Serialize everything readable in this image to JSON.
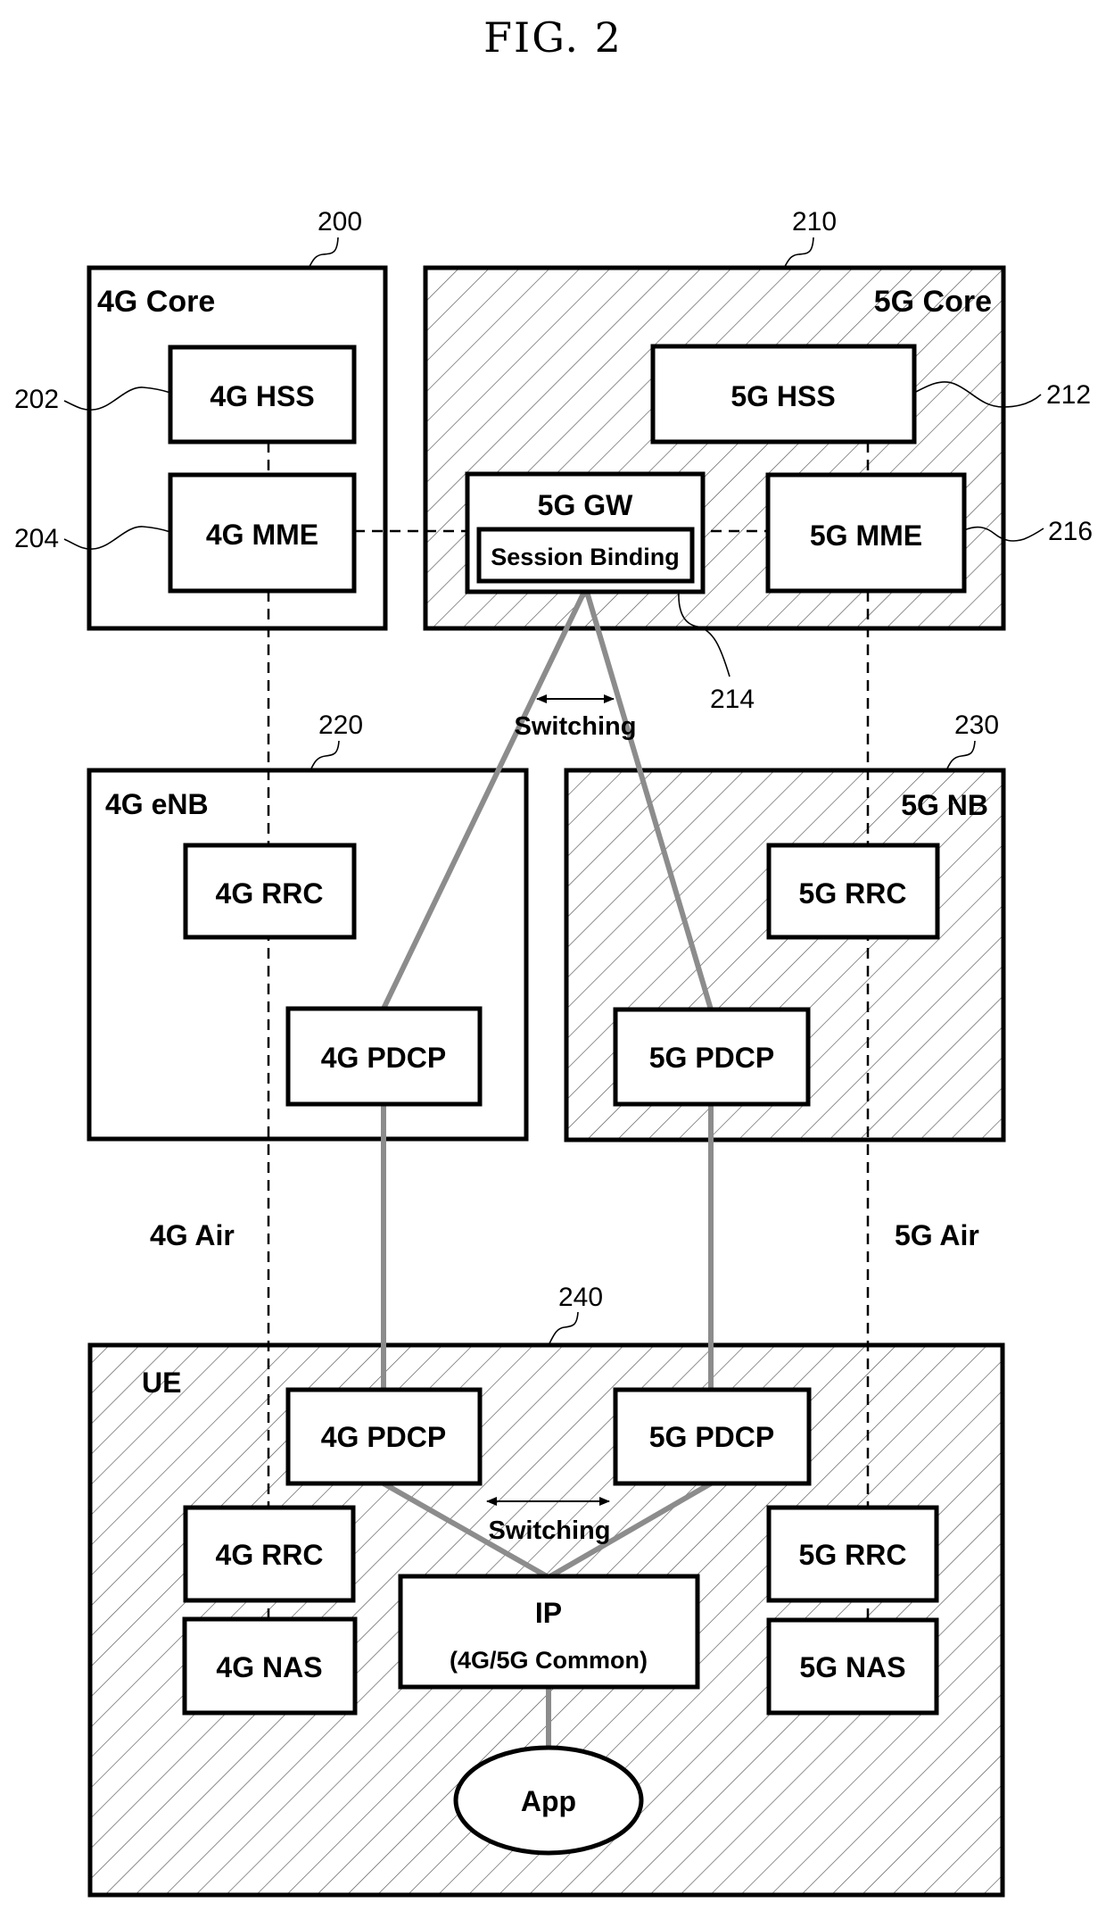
{
  "figure_title": "FIG. 2",
  "colors": {
    "line": "#000000",
    "user_plane": "#8c8c8c",
    "hatch": "#555555",
    "background": "#ffffff"
  },
  "groups": {
    "core_4g": {
      "label": "4G Core",
      "ref": "200",
      "hatched": false
    },
    "core_5g": {
      "label": "5G Core",
      "ref": "210",
      "hatched": true
    },
    "enb_4g": {
      "label": "4G eNB",
      "ref": "220",
      "hatched": false
    },
    "nb_5g": {
      "label": "5G NB",
      "ref": "230",
      "hatched": true
    },
    "ue": {
      "label": "UE",
      "ref": "240",
      "hatched": true
    }
  },
  "nodes": {
    "hss_4g": {
      "label": "4G HSS",
      "ref": "202"
    },
    "mme_4g": {
      "label": "4G MME",
      "ref": "204"
    },
    "hss_5g": {
      "label": "5G HSS",
      "ref": "212"
    },
    "gw_5g": {
      "label": "5G GW",
      "ref": "214"
    },
    "session_binding": {
      "label": "Session Binding"
    },
    "mme_5g": {
      "label": "5G MME",
      "ref": "216"
    },
    "enb_rrc_4g": {
      "label": "4G RRC"
    },
    "enb_pdcp_4g": {
      "label": "4G PDCP"
    },
    "nb_rrc_5g": {
      "label": "5G RRC"
    },
    "nb_pdcp_5g": {
      "label": "5G PDCP"
    },
    "ue_pdcp_4g": {
      "label": "4G PDCP"
    },
    "ue_pdcp_5g": {
      "label": "5G PDCP"
    },
    "ue_rrc_4g": {
      "label": "4G RRC"
    },
    "ue_nas_4g": {
      "label": "4G NAS"
    },
    "ue_rrc_5g": {
      "label": "5G RRC"
    },
    "ue_nas_5g": {
      "label": "5G NAS"
    },
    "ip": {
      "label": "IP",
      "sublabel": "(4G/5G Common)"
    },
    "app": {
      "label": "App"
    }
  },
  "annotations": {
    "switching_core": "Switching",
    "switching_ue": "Switching",
    "air_4g": "4G Air",
    "air_5g": "5G Air"
  }
}
